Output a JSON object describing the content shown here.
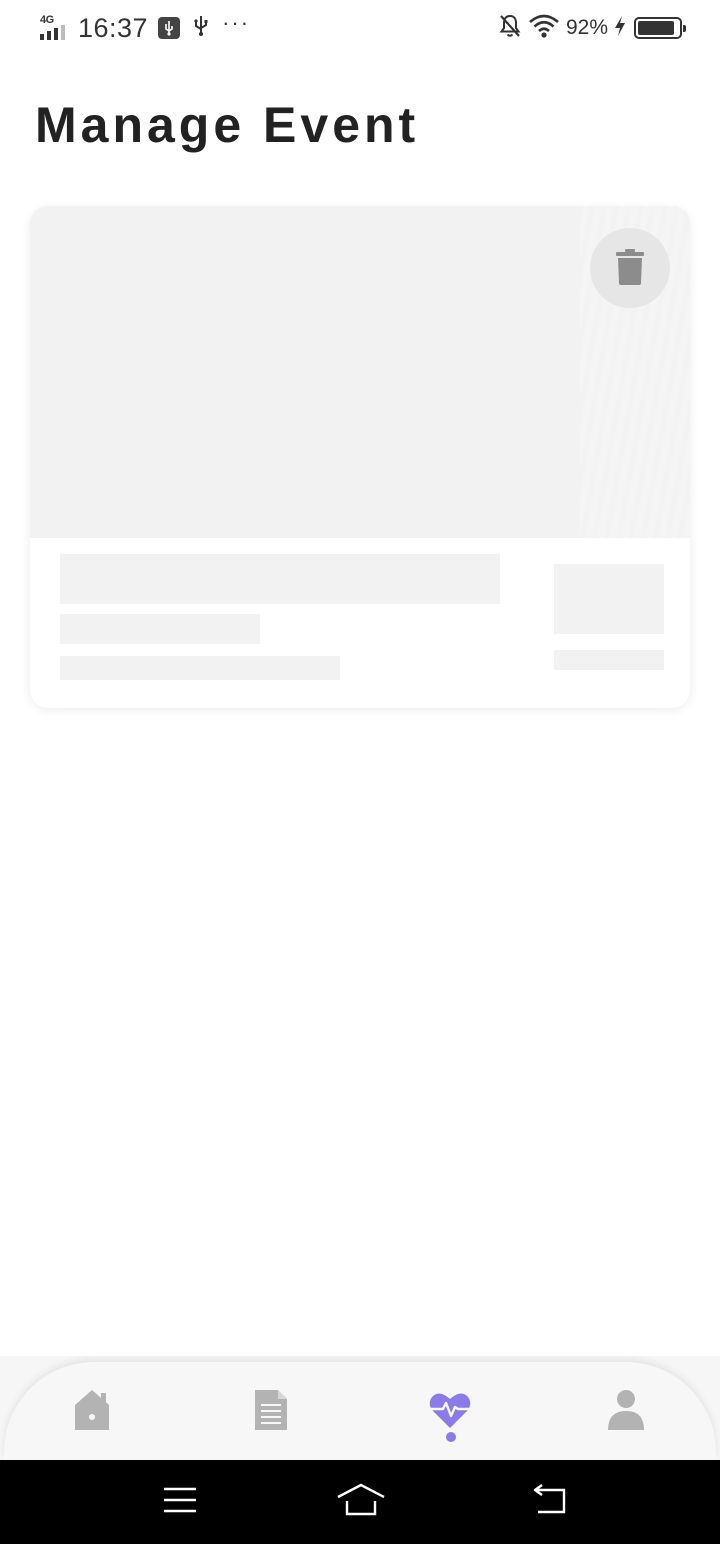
{
  "status_bar": {
    "network": "4G",
    "time": "16:37",
    "more": "···",
    "battery_percent": "92%",
    "battery_level": 0.92
  },
  "page": {
    "title": "Manage Event"
  },
  "event_card": {
    "delete_icon": "trash-icon",
    "placeholder_color": "#f2f2f2"
  },
  "bottom_nav": {
    "items": [
      {
        "icon": "home-icon",
        "active": false
      },
      {
        "icon": "document-icon",
        "active": false
      },
      {
        "icon": "heart-pulse-icon",
        "active": true
      },
      {
        "icon": "profile-icon",
        "active": false
      }
    ],
    "active_color": "#8b7be6",
    "inactive_color": "#b3b3b3"
  },
  "system_nav": {
    "items": [
      "menu-icon",
      "home-icon",
      "back-icon"
    ]
  }
}
